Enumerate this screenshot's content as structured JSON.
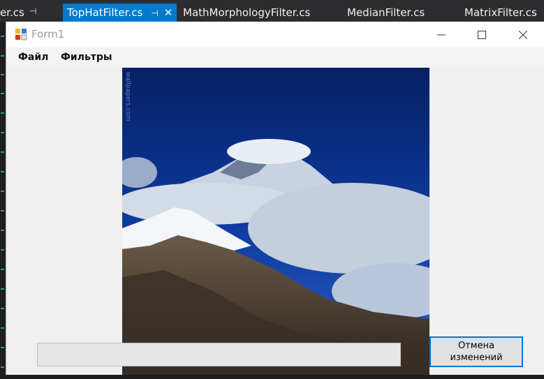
{
  "ide": {
    "tabs": [
      {
        "label": "er.cs"
      },
      {
        "label": "TopHatFilter.cs",
        "active": true
      },
      {
        "label": "MathMorphologyFilter.cs"
      },
      {
        "label": "MedianFilter.cs"
      },
      {
        "label": "MatrixFilter.cs"
      }
    ],
    "pin_glyph": "⊣",
    "close_glyph": "✕"
  },
  "form": {
    "title": "Form1",
    "menu": [
      {
        "label": "Файл"
      },
      {
        "label": "Фильтры"
      }
    ],
    "image": {
      "watermark": "wallpapers.com"
    },
    "progress": {
      "value": 0
    },
    "cancel_button": {
      "label": "Отмена изменений"
    }
  },
  "colors": {
    "accent": "#007acc",
    "sky": "#0b2777",
    "button_border": "#0078d7"
  },
  "icons": [
    "pin-icon",
    "close-icon",
    "app-icon",
    "minimize-icon",
    "maximize-icon",
    "window-close-icon"
  ]
}
